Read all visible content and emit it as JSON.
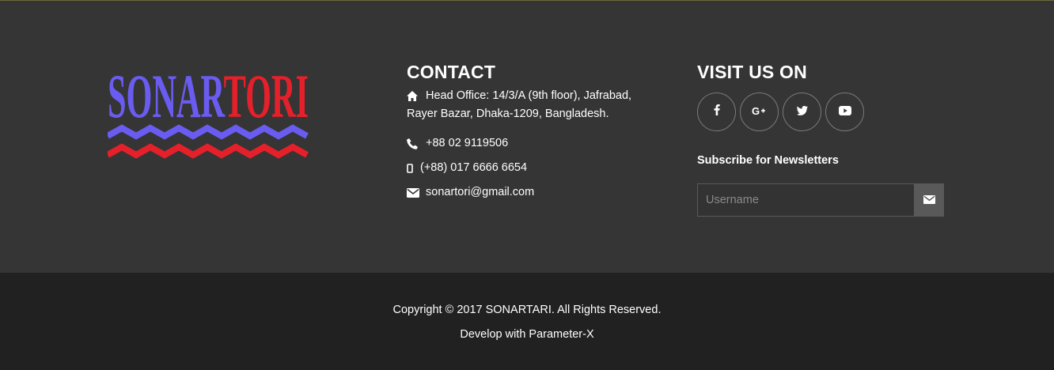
{
  "logo": {
    "part1": "SONAR",
    "part2": "TORI",
    "color1": "#6a5cf0",
    "color2": "#e6202a"
  },
  "contact": {
    "title": "CONTACT",
    "address_label": "Head Office: 14/3/A (9th floor), Jafrabad,",
    "address_line2": "Rayer Bazar, Dhaka-1209, Bangladesh.",
    "phone": "+88 02 9119506",
    "mobile": "(+88) 017 6666 6654",
    "email": "sonartori@gmail.com",
    "icons": [
      "home-icon",
      "phone-icon",
      "mobile-icon",
      "envelope-icon"
    ]
  },
  "visit": {
    "title": "VISIT US ON",
    "socials": [
      "facebook-icon",
      "google-plus-icon",
      "twitter-icon",
      "youtube-icon"
    ],
    "subscribe_title": "Subscribe for Newsletters",
    "input_placeholder": "Username"
  },
  "footer": {
    "copyright": "Copyright © 2017 SONARTARI. All Rights Reserved.",
    "develop": "Develop with Parameter-X"
  },
  "colors": {
    "main_bg": "#353535",
    "bottom_bg": "#212121",
    "text": "#ffffff"
  }
}
